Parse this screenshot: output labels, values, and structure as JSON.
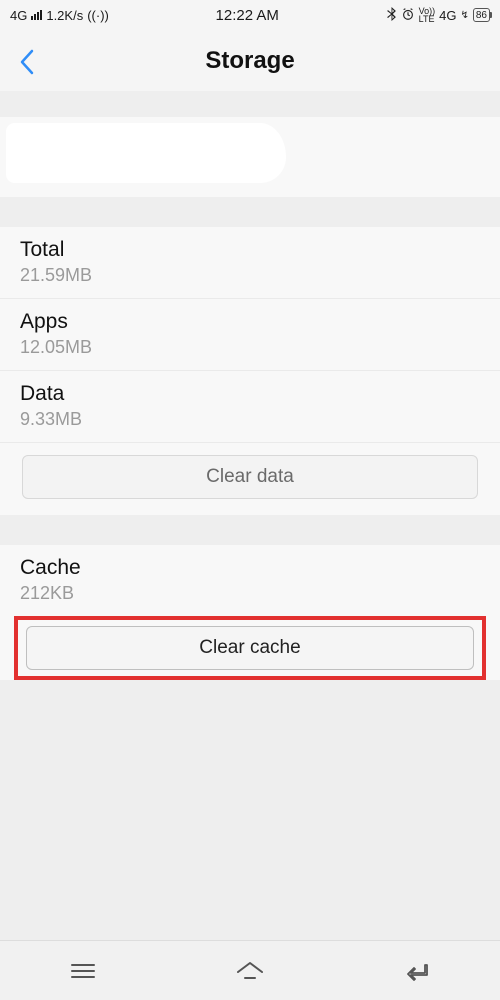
{
  "statusbar": {
    "network_type": "4G",
    "data_rate": "1.2K/s",
    "time": "12:22 AM",
    "secondary_network": "4G",
    "battery_pct": "86"
  },
  "header": {
    "title": "Storage"
  },
  "storage": {
    "total": {
      "label": "Total",
      "value": "21.59MB"
    },
    "apps": {
      "label": "Apps",
      "value": "12.05MB"
    },
    "data": {
      "label": "Data",
      "value": "9.33MB"
    },
    "clear_data_label": "Clear data",
    "cache": {
      "label": "Cache",
      "value": "212KB"
    },
    "clear_cache_label": "Clear cache"
  }
}
